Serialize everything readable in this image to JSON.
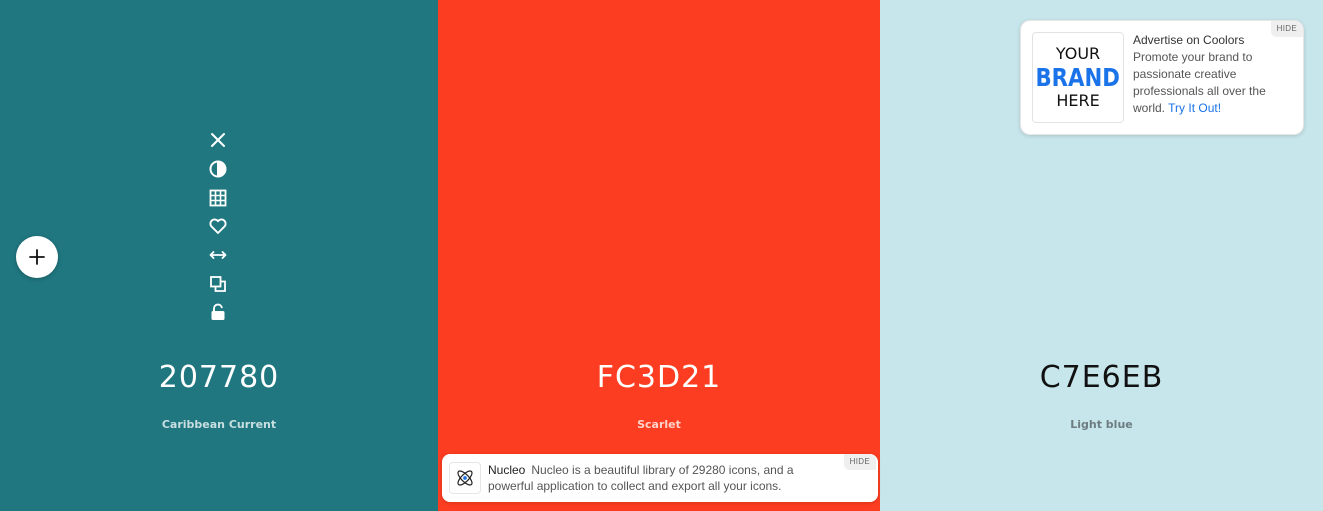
{
  "swatches": [
    {
      "hex": "207780",
      "name": "Caribbean Current",
      "bg": "#207780",
      "fg": "#ffffff",
      "name_fg": "#c8dfe1"
    },
    {
      "hex": "FC3D21",
      "name": "Scarlet",
      "bg": "#FC3D21",
      "fg": "#ffffff",
      "name_fg": "#ffd2ca"
    },
    {
      "hex": "C7E6EB",
      "name": "Light blue",
      "bg": "#C7E6EB",
      "fg": "#111111",
      "name_fg": "#6c7c80"
    }
  ],
  "tools": [
    {
      "icon": "close-icon",
      "action": "remove"
    },
    {
      "icon": "contrast-icon",
      "action": "shades"
    },
    {
      "icon": "grid-icon",
      "action": "view-shades"
    },
    {
      "icon": "heart-icon",
      "action": "save"
    },
    {
      "icon": "drag-arrows-icon",
      "action": "drag"
    },
    {
      "icon": "copy-icon",
      "action": "copy"
    },
    {
      "icon": "unlock-icon",
      "action": "lock"
    }
  ],
  "add_button": {
    "icon": "plus-icon"
  },
  "ad_top": {
    "logo_line1": "YOUR",
    "logo_line2": "BRAND",
    "logo_line3": "HERE",
    "title": "Advertise on Coolors",
    "body": "Promote your brand to passionate creative professionals all over the world.",
    "cta": "Try It Out!",
    "hide": "HIDE"
  },
  "ad_bottom": {
    "icon": "atom-icon",
    "title": "Nucleo",
    "body": "Nucleo is a beautiful library of 29280 icons, and a powerful application to collect and export all your icons.",
    "hide": "HIDE"
  }
}
